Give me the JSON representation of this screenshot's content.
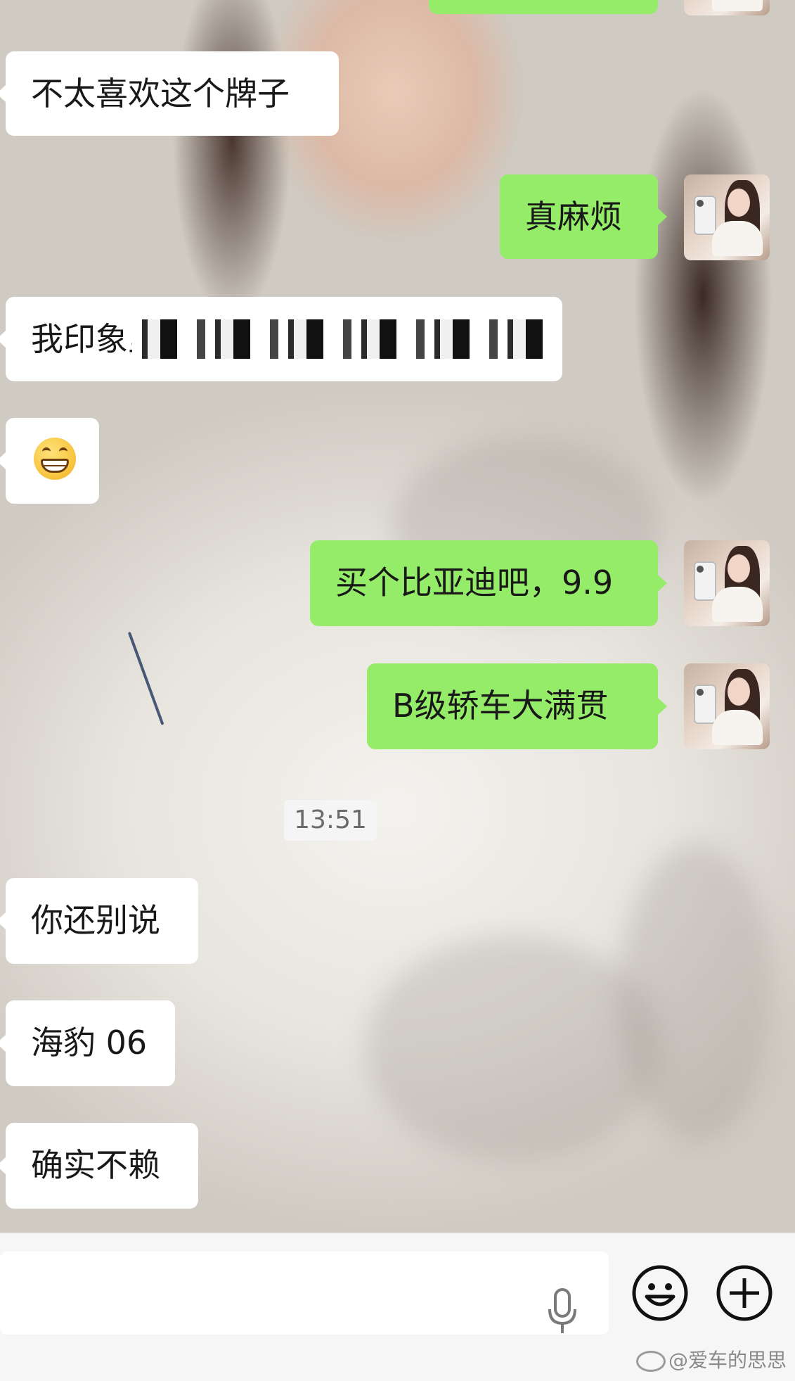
{
  "messages": [
    {
      "from": "other",
      "text": "不太喜欢这个牌子"
    },
    {
      "from": "me",
      "text": "真麻烦"
    },
    {
      "from": "other",
      "text": "我印象里",
      "redacted": true
    },
    {
      "from": "other",
      "emoji": "grinning-face-emoji"
    },
    {
      "from": "me",
      "text": "买个比亚迪吧，9.9"
    },
    {
      "from": "me",
      "text": "B级轿车大满贯"
    },
    {
      "from": "other",
      "text": "你还别说"
    },
    {
      "from": "other",
      "text": "海豹 06"
    },
    {
      "from": "other",
      "text": "确实不赖"
    }
  ],
  "timestamp": "13:51",
  "input": {
    "placeholder": ""
  },
  "watermark": "@爱车的思思",
  "colors": {
    "outgoing_bubble": "#95ec69",
    "incoming_bubble": "#ffffff",
    "input_bar": "#f6f6f6"
  },
  "icons": [
    "mic-icon",
    "emoji-icon",
    "plus-icon",
    "weibo-icon"
  ]
}
